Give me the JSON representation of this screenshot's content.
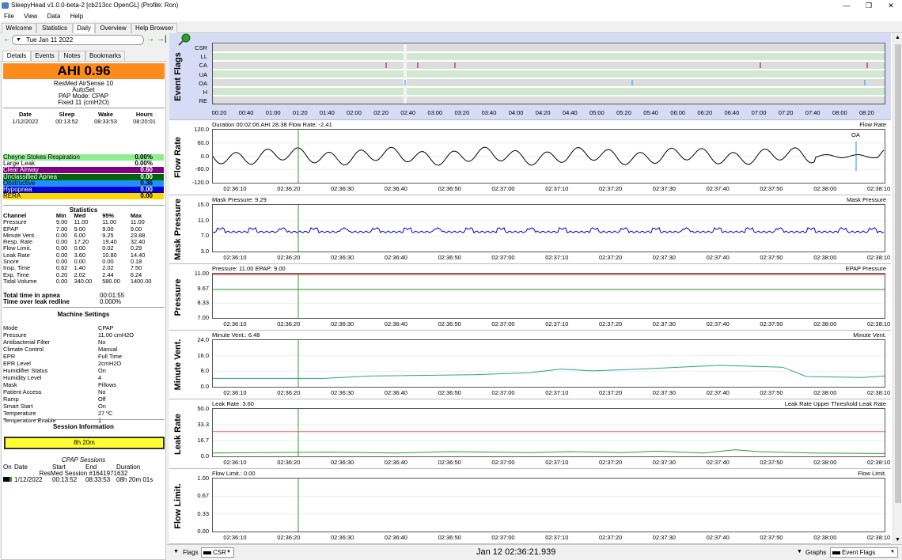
{
  "window": {
    "title": "SleepyHead v1.0.0-beta-2 [cb213cc OpenGL] (Profile: Ron)",
    "minimize": "—",
    "maximize": "❐",
    "close": "✕"
  },
  "menu": [
    "File",
    "View",
    "Data",
    "Help"
  ],
  "tabs": [
    "Welcome",
    "Statistics",
    "Daily",
    "Overview",
    "Help Browser"
  ],
  "date": {
    "value": "Tue Jan 11 2022",
    "prev": "←",
    "next": "→",
    "last": "→|"
  },
  "subtabs": [
    "Details",
    "Events",
    "Notes",
    "Bookmarks"
  ],
  "ahi": "AHI 0.96",
  "machine": {
    "name": "ResMed AirSense 10",
    "model": "AutoSet",
    "mode": "PAP Mode: CPAP",
    "fixed": "Fixed 11 (cmH2O)"
  },
  "times": {
    "headers": [
      "Date",
      "Sleep",
      "Wake",
      "Hours"
    ],
    "values": [
      "1/12/2022",
      "00:13:52",
      "08:33:53",
      "08:20:01"
    ]
  },
  "events": [
    {
      "label": "Cheyne Stokes Respiration",
      "value": "0.00%",
      "color": "#90ee90"
    },
    {
      "label": "Large Leak",
      "value": "0.00%",
      "color": "#ffffff"
    },
    {
      "label": "Clear Airway",
      "value": "0.60",
      "color": "#800080",
      "text": "#ffffff"
    },
    {
      "label": "Unclassified Apnea",
      "value": "0.00",
      "color": "#006400",
      "text": "#ffffff"
    },
    {
      "label": "Obstructive",
      "value": "0.36",
      "color": "#1e90ff",
      "text": "#000000"
    },
    {
      "label": "Hypopnea",
      "value": "0.00",
      "color": "#0000cd",
      "text": "#ffffff"
    },
    {
      "label": "RERA",
      "value": "0.00",
      "color": "#ffd700",
      "text": "#000000"
    }
  ],
  "statistics": {
    "title": "Statistics",
    "headers": [
      "Channel",
      "Min",
      "Med",
      "95%",
      "Max"
    ],
    "rows": [
      [
        "Pressure",
        "9.00",
        "11.00",
        "11.00",
        "11.00"
      ],
      [
        "EPAP",
        "7.00",
        "9.00",
        "9.00",
        "9.00"
      ],
      [
        "Minute Vent.",
        "0.00",
        "6.00",
        "9.25",
        "23.88"
      ],
      [
        "Resp. Rate",
        "0.00",
        "17.20",
        "19.40",
        "32.40"
      ],
      [
        "Flow Limit.",
        "0.00",
        "0.00",
        "0.02",
        "0.29"
      ],
      [
        "Leak Rate",
        "0.00",
        "3.60",
        "10.80",
        "14.40"
      ],
      [
        "Snore",
        "0.00",
        "0.00",
        "0.00",
        "0.18"
      ],
      [
        "Insp. Time",
        "0.62",
        "1.40",
        "2.02",
        "7.50"
      ],
      [
        "Exp. Time",
        "0.20",
        "2.02",
        "2.44",
        "6.24"
      ],
      [
        "Tidal Volume",
        "0.00",
        "340.00",
        "580.00",
        "1400.00"
      ]
    ]
  },
  "apnea": [
    {
      "label": "Total time in apnea",
      "value": "00:01:55"
    },
    {
      "label": "Time over leak redline",
      "value": "0.000%"
    }
  ],
  "settings": {
    "title": "Machine Settings",
    "rows": [
      [
        "Mode",
        "CPAP"
      ],
      [
        "Pressure",
        "11.00 cmH2O"
      ],
      [
        "Antibacterial Filter",
        "No"
      ],
      [
        "Climate Control",
        "Manual"
      ],
      [
        "EPR",
        "Full Time"
      ],
      [
        "EPR Level",
        "2cmH2O"
      ],
      [
        "Humidifier Status",
        "On"
      ],
      [
        "Humidity Level",
        "4"
      ],
      [
        "Mask",
        "Pillows"
      ],
      [
        "Patient Access",
        "No"
      ],
      [
        "Ramp",
        "Off"
      ],
      [
        "Smart Start",
        "On"
      ],
      [
        "Temperature",
        "27 ºC"
      ],
      [
        "Temperature Enable",
        "1"
      ]
    ]
  },
  "session": {
    "title": "Session Information",
    "bar": "8h 20m",
    "cpap_title": "CPAP Sessions",
    "headers": [
      "On",
      "Date",
      "Start",
      "End",
      "Duration"
    ],
    "sub": "ResMed Session #1641971632",
    "row": [
      "1/12/2022",
      "00:13:52",
      "08:33:53",
      "08h 20m 01s"
    ]
  },
  "eventflags": {
    "title": "Event Flags",
    "labels": [
      "CSR",
      "LL",
      "CA",
      "UA",
      "OA",
      "H",
      "RE"
    ],
    "xticks": [
      "00:20",
      "00:40",
      "01:00",
      "01:20",
      "01:40",
      "02:00",
      "02:20",
      "02:40",
      "03:00",
      "03:20",
      "03:40",
      "04:00",
      "04:20",
      "04:40",
      "05:00",
      "05:20",
      "05:40",
      "06:00",
      "06:20",
      "06:40",
      "07:00",
      "07:20",
      "07:40",
      "08:00",
      "08:20"
    ]
  },
  "xticks_detail": [
    "02:36:10",
    "02:36:20",
    "02:36:30",
    "02:36:40",
    "02:36:50",
    "02:37:00",
    "02:37:10",
    "02:37:20",
    "02:37:30",
    "02:37:40",
    "02:37:50",
    "02:38:00",
    "02:38:10"
  ],
  "graphs": [
    {
      "title": "Flow Rate",
      "info": "Duration 00:02:06 AHI 28.38 Flow Rate: -2.41",
      "legend": "Flow Rate",
      "yticks": [
        "120.0",
        "60.0",
        "0.0",
        "-60.0",
        "-120.0"
      ],
      "annotation": "OA"
    },
    {
      "title": "Mask Pressure",
      "info": "Mask Pressure: 9.29",
      "legend": "Mask Pressure",
      "yticks": [
        "15.0",
        "11.0",
        "7.0",
        "3.0"
      ]
    },
    {
      "title": "Pressure",
      "info": "Pressure: 11.00 EPAP: 9.00",
      "legend": "EPAP Pressure",
      "yticks": [
        "11.00",
        "9.67",
        "8.33",
        "7.00"
      ]
    },
    {
      "title": "Minute Vent.",
      "info": "Minute Vent.: 6.48",
      "legend": "Minute Vent.",
      "yticks": [
        "24.0",
        "16.0",
        "8.0",
        "0.0"
      ]
    },
    {
      "title": "Leak Rate",
      "info": "Leak Rate: 3.60",
      "legend": "Leak Rate Upper Threshold Leak Rate",
      "yticks": [
        "50.0",
        "33.3",
        "16.7",
        "0.0"
      ]
    },
    {
      "title": "Flow Limit.",
      "info": "Flow Limit.: 0.00",
      "legend": "Flow Limit.",
      "yticks": [
        "1.00",
        "0.67",
        "0.33",
        "0.00"
      ]
    }
  ],
  "bottom": {
    "flags": "Flags",
    "csr": "CSR",
    "time": "Jan 12 02:36:21.939",
    "graphs": "Graphs",
    "eventflags": "Event Flags"
  },
  "colors": {
    "flow": "#000000",
    "mask": "#0000cc",
    "epap": "#2ca02c",
    "pressure": "#cc0000",
    "minvent": "#2aa198",
    "leak": "#2ca02c",
    "threshold": "#ff6666",
    "cursor": "#2ca02c",
    "ahi": "#ff8c1a"
  }
}
